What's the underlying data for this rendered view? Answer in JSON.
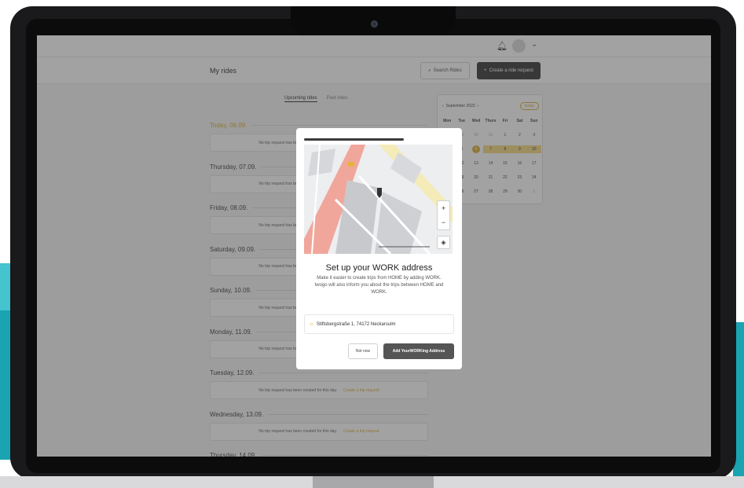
{
  "header": {
    "page_title": "My rides",
    "search_label": "Search Rides",
    "create_label": "Create a ride request"
  },
  "tabs": [
    {
      "label": "Upcoming rides"
    },
    {
      "label": "Past rides"
    }
  ],
  "days": [
    {
      "label": "Today, 06.09.",
      "today": true,
      "empty_text": "No trip request has been created for this day.",
      "link": "Create a trip request"
    },
    {
      "label": "Thursday, 07.09.",
      "empty_text": "No trip request has been created for this day.",
      "link": "Create a trip request"
    },
    {
      "label": "Friday, 08.09.",
      "empty_text": "No trip request has been created for this day.",
      "link": "Create a trip request"
    },
    {
      "label": "Saturday, 09.09.",
      "empty_text": "No trip request has been created for this day.",
      "link": "Create a trip request"
    },
    {
      "label": "Sunday, 10.09.",
      "empty_text": "No trip request has been created for this day.",
      "link": "Create a trip request"
    },
    {
      "label": "Monday, 11.09.",
      "empty_text": "No trip request has been created for this day.",
      "link": "Create a trip request"
    },
    {
      "label": "Tuesday, 12.09.",
      "empty_text": "No trip request has been created for this day.",
      "link": "Create a trip request"
    },
    {
      "label": "Wednesday, 13.09.",
      "empty_text": "No trip request has been created for this day.",
      "link": "Create a trip request"
    },
    {
      "label": "Thursday, 14.09."
    }
  ],
  "calendar": {
    "month_label": "September 2023",
    "today_label": "today",
    "weekdays": [
      "Mon",
      "Tue",
      "Wed",
      "Thurs",
      "Fri",
      "Sat",
      "Sun"
    ],
    "cells": [
      {
        "d": "28",
        "m": true
      },
      {
        "d": "29",
        "m": true
      },
      {
        "d": "30",
        "m": true
      },
      {
        "d": "31",
        "m": true
      },
      {
        "d": "1"
      },
      {
        "d": "2"
      },
      {
        "d": "3"
      },
      {
        "d": "4"
      },
      {
        "d": "5"
      },
      {
        "d": "6",
        "cur": true
      },
      {
        "d": "7",
        "sel": true
      },
      {
        "d": "8",
        "sel": true
      },
      {
        "d": "9",
        "sel": true
      },
      {
        "d": "10",
        "sel": true
      },
      {
        "d": "11"
      },
      {
        "d": "12"
      },
      {
        "d": "13"
      },
      {
        "d": "14"
      },
      {
        "d": "15"
      },
      {
        "d": "16"
      },
      {
        "d": "17"
      },
      {
        "d": "18"
      },
      {
        "d": "19"
      },
      {
        "d": "20"
      },
      {
        "d": "21"
      },
      {
        "d": "22"
      },
      {
        "d": "23"
      },
      {
        "d": "24"
      },
      {
        "d": "25"
      },
      {
        "d": "26"
      },
      {
        "d": "27"
      },
      {
        "d": "28"
      },
      {
        "d": "29"
      },
      {
        "d": "30"
      },
      {
        "d": "1",
        "m": true
      }
    ]
  },
  "modal": {
    "title": "Set up your WORK address",
    "description": "Make it easier to create trips from HOME by adding WORK. twogo will also inform you about the trips between HOME and WORK.",
    "address": "Stiftsbergstraße 1, 74172 Neckarsulm",
    "not_now_label": "Not now",
    "add_label": "Add YourWORKing Address",
    "zoom_in": "+",
    "zoom_out": "−"
  },
  "colors": {
    "accent": "#d7a82a",
    "dark_button": "#2b2b2b",
    "teal": "#1aa3b1"
  }
}
